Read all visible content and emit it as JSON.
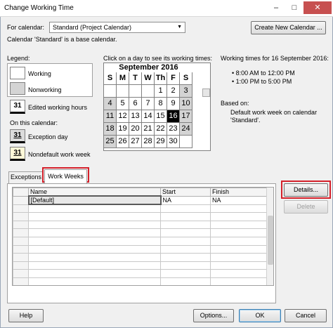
{
  "window": {
    "title": "Change Working Time",
    "minimize": "–",
    "maximize": "□",
    "close": "✕"
  },
  "calendar_selector": {
    "label": "For calendar:",
    "value": "Standard (Project Calendar)",
    "create_button": "Create New Calendar ...",
    "info": "Calendar 'Standard' is a base calendar."
  },
  "legend": {
    "title": "Legend:",
    "working": "Working",
    "nonworking": "Nonworking",
    "edited_icon": "31",
    "edited": "Edited working hours",
    "on_this_calendar": "On this calendar:",
    "exception_icon": "31",
    "exception": "Exception day",
    "nondefault_icon": "31",
    "nondefault": "Nondefault work week"
  },
  "calendar": {
    "instruction": "Click on a day to see its working times:",
    "month": "September 2016",
    "day_headers": [
      "S",
      "M",
      "T",
      "W",
      "Th",
      "F",
      "S"
    ],
    "days": [
      [
        "",
        "",
        "",
        "",
        "1",
        "2",
        "3"
      ],
      [
        "4",
        "5",
        "6",
        "7",
        "8",
        "9",
        "10"
      ],
      [
        "11",
        "12",
        "13",
        "14",
        "15",
        "16",
        "17"
      ],
      [
        "18",
        "19",
        "20",
        "21",
        "22",
        "23",
        "24"
      ],
      [
        "25",
        "26",
        "27",
        "28",
        "29",
        "30",
        ""
      ]
    ],
    "selected_day": "16",
    "colors": {
      "weekend": "#d4d4d4",
      "selected": "#000000"
    }
  },
  "working_times": {
    "title": "Working times for 16 September 2016:",
    "times": [
      "• 8:00 AM to 12:00 PM",
      "• 1:00 PM to 5:00 PM"
    ],
    "based_on_label": "Based on:",
    "based_on_text_1": "Default work week on calendar",
    "based_on_text_2": "'Standard'."
  },
  "tabs": {
    "exceptions": "Exceptions",
    "work_weeks": "Work Weeks"
  },
  "grid": {
    "columns": [
      "",
      "Name",
      "Start",
      "Finish"
    ],
    "rows": [
      {
        "name": "[Default]",
        "start": "NA",
        "finish": "NA"
      }
    ],
    "empty_rows": 13
  },
  "side_buttons": {
    "details": "Details...",
    "delete": "Delete"
  },
  "footer": {
    "help": "Help",
    "options": "Options...",
    "ok": "OK",
    "cancel": "Cancel"
  },
  "colors": {
    "highlight": "#d4202a",
    "background": "#f0f0f0"
  }
}
